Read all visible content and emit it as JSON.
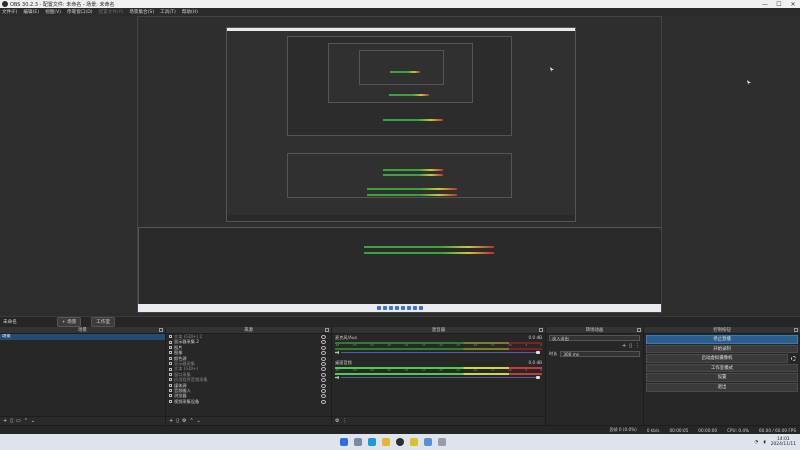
{
  "window": {
    "title": "OBS 30.2.3 - 配置文件: 未命名 - 场景: 未命名",
    "minimize": "—",
    "maximize": "☐",
    "close": "✕"
  },
  "menu": [
    {
      "label": "文件(F)",
      "enabled": true
    },
    {
      "label": "编辑(E)",
      "enabled": true
    },
    {
      "label": "视图(V)",
      "enabled": true
    },
    {
      "label": "停靠窗口(D)",
      "enabled": true
    },
    {
      "label": "配置文件(P)",
      "enabled": false
    },
    {
      "label": "场景集合(S)",
      "enabled": true
    },
    {
      "label": "工具(T)",
      "enabled": true
    },
    {
      "label": "帮助(H)",
      "enabled": true
    }
  ],
  "scene_bar": {
    "label": "未命名",
    "btn_add": "+ 场景",
    "btn_studio": "工作室"
  },
  "scenes": {
    "title": "场景",
    "items": [
      "场景"
    ]
  },
  "sources": {
    "title": "来源",
    "items": [
      {
        "label": "文本 (GDI+) 2",
        "dim": true
      },
      {
        "label": "显示器采集 2",
        "dim": false
      },
      {
        "label": "图片",
        "dim": false
      },
      {
        "label": "图像",
        "dim": false
      },
      {
        "label": "颜色源",
        "dim": false
      },
      {
        "label": "显示器采集",
        "dim": true
      },
      {
        "label": "文本 (GDI+)",
        "dim": true
      },
      {
        "label": "窗口采集",
        "dim": true
      },
      {
        "label": "应用程序音频采集",
        "dim": true
      },
      {
        "label": "媒体源",
        "dim": false
      },
      {
        "label": "音频输入",
        "dim": false
      },
      {
        "label": "浏览器",
        "dim": false
      },
      {
        "label": "视频采集设备",
        "dim": false
      }
    ]
  },
  "mixer": {
    "title": "混音器",
    "scale": [
      "-60",
      "-55",
      "-50",
      "-45",
      "-40",
      "-35",
      "-30",
      "-25",
      "-20",
      "-15",
      "-10",
      "-5",
      "0"
    ],
    "channels": [
      {
        "name": "麦克风/Aux",
        "db": "0.0 dB"
      },
      {
        "name": "桌面音频",
        "db": "0.0 dB"
      }
    ]
  },
  "transitions": {
    "title": "转场动画",
    "selected": "淡入淡出",
    "duration_label": "时长",
    "duration_value": "300 ms"
  },
  "controls": {
    "title": "控制按钮",
    "buttons": [
      {
        "label": "停止直播",
        "active": true
      },
      {
        "label": "开始录制",
        "active": false
      },
      {
        "label": "启动虚拟摄像机",
        "active": false
      },
      {
        "label": "工作室模式",
        "active": false
      },
      {
        "label": "设置",
        "active": false
      },
      {
        "label": "退出",
        "active": false
      }
    ]
  },
  "status": {
    "dropped": "丢帧 0 (0.0%)",
    "kbps": "0 kb/s",
    "stream_time": "00:00:05",
    "rec_time": "00:00:00",
    "cpu": "CPU: 0.4%",
    "fps": "60.00 / 60.00 FPS"
  },
  "clock": {
    "time": "14:01",
    "date": "2024/11/11"
  },
  "colors": {
    "accent": "#2b5e8c",
    "meter_green": "#49d049",
    "meter_yellow": "#d4d43c",
    "meter_red": "#c83a3a"
  }
}
